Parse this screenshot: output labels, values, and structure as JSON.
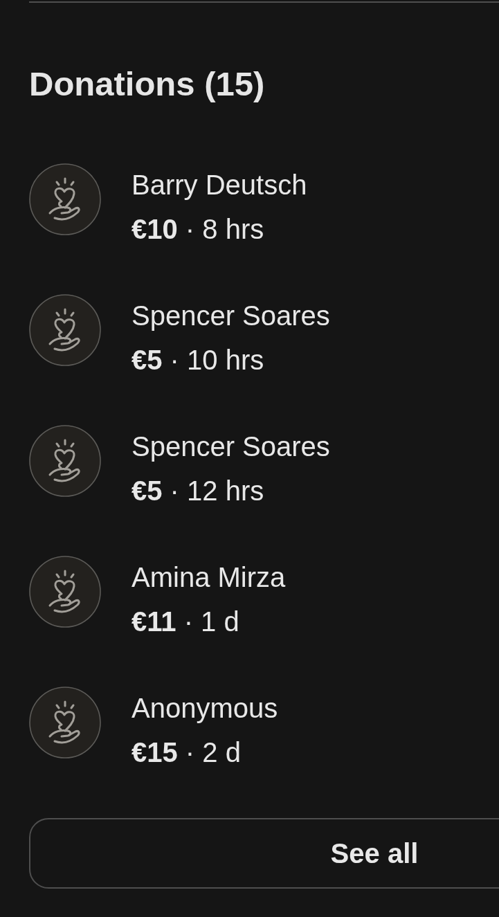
{
  "heading": "Donations (15)",
  "donations": [
    {
      "name": "Barry Deutsch",
      "detail": "**€10** · 8 hrs"
    },
    {
      "name": "Spencer Soares",
      "detail": "**€5** · 10 hrs"
    },
    {
      "name": "Spencer Soares",
      "detail": "**€5** · 12 hrs"
    },
    {
      "name": "Amina Mirza",
      "detail": "**€11** · 1 d"
    },
    {
      "name": "Anonymous",
      "detail": "**€15** · 2 d"
    }
  ],
  "see_all_button": {
    "label": "See all"
  }
}
